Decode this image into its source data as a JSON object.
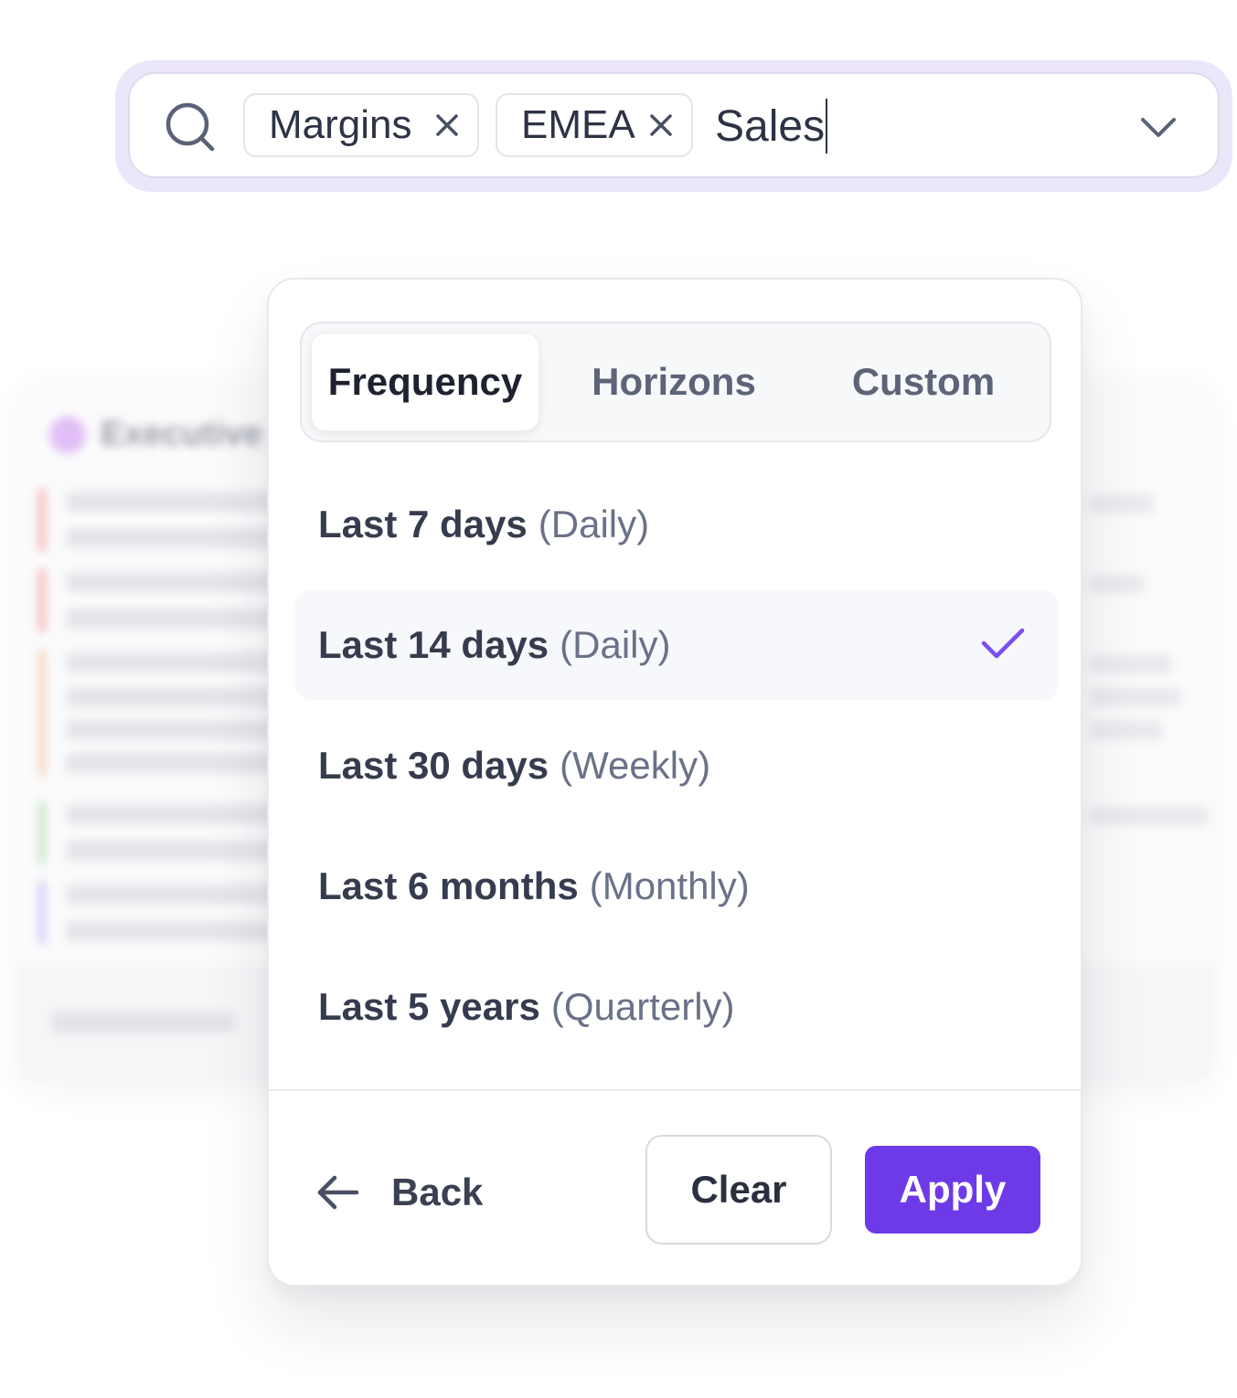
{
  "search": {
    "chips": [
      {
        "label": "Margins"
      },
      {
        "label": "EMEA"
      }
    ],
    "query": "Sales"
  },
  "popover": {
    "tabs": [
      {
        "label": "Frequency",
        "active": true
      },
      {
        "label": "Horizons",
        "active": false
      },
      {
        "label": "Custom",
        "active": false
      }
    ],
    "options": [
      {
        "main": "Last 7 days",
        "sub": "(Daily)",
        "selected": false
      },
      {
        "main": "Last 14 days",
        "sub": "(Daily)",
        "selected": true
      },
      {
        "main": "Last 30 days",
        "sub": "(Weekly)",
        "selected": false
      },
      {
        "main": "Last 6 months",
        "sub": "(Monthly)",
        "selected": false
      },
      {
        "main": "Last 5 years",
        "sub": "(Quarterly)",
        "selected": false
      }
    ],
    "footer": {
      "back_label": "Back",
      "clear_label": "Clear",
      "apply_label": "Apply"
    }
  },
  "background_card": {
    "title": "Executive I"
  },
  "colors": {
    "accent": "#6e3ae8",
    "check": "#7a4ff0",
    "focus_ring": "#ece6fb"
  },
  "icons": {
    "search": "search-icon",
    "chip_remove": "close-icon",
    "dropdown": "chevron-down-icon",
    "selected": "check-icon",
    "back": "arrow-left-icon"
  }
}
